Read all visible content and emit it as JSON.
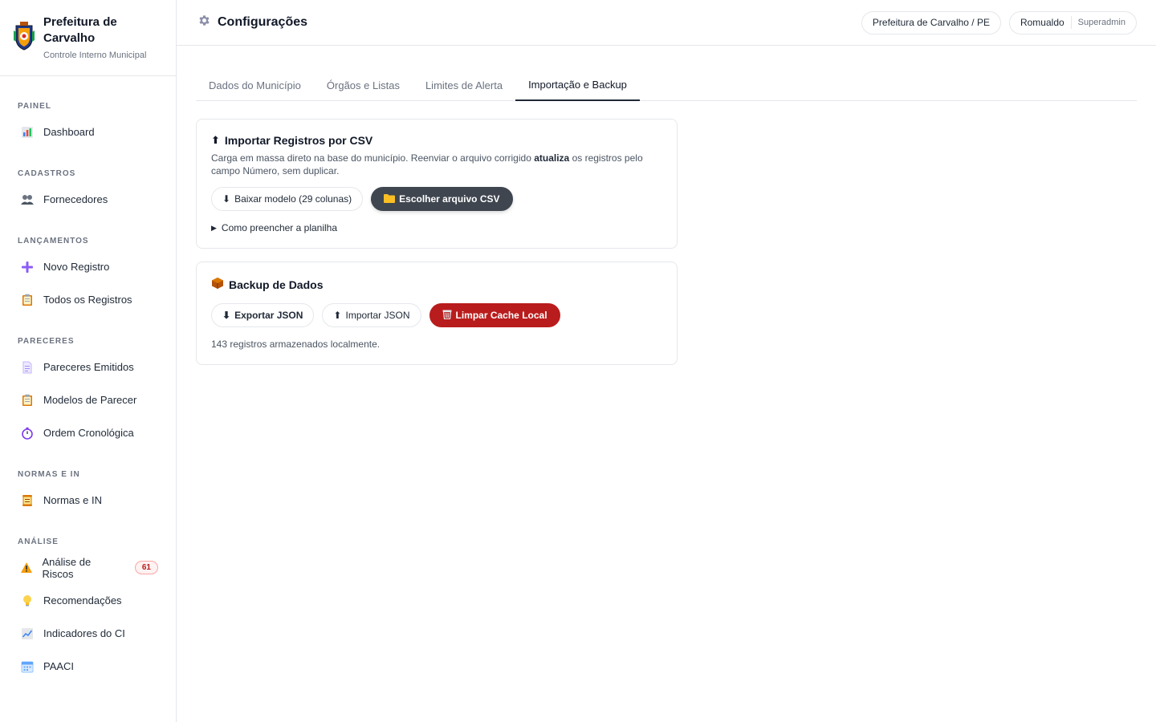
{
  "brand": {
    "title": "Prefeitura de Carvalho",
    "subtitle": "Controle Interno Municipal"
  },
  "sidebar": {
    "sections": [
      {
        "label": "PAINEL",
        "items": [
          {
            "label": "Dashboard",
            "icon": "chart-icon"
          }
        ]
      },
      {
        "label": "CADASTROS",
        "items": [
          {
            "label": "Fornecedores",
            "icon": "users-icon"
          }
        ]
      },
      {
        "label": "LANÇAMENTOS",
        "items": [
          {
            "label": "Novo Registro",
            "icon": "plus-icon"
          },
          {
            "label": "Todos os Registros",
            "icon": "clipboard-icon"
          }
        ]
      },
      {
        "label": "PARECERES",
        "items": [
          {
            "label": "Pareceres Emitidos",
            "icon": "document-icon"
          },
          {
            "label": "Modelos de Parecer",
            "icon": "clipboard-icon"
          },
          {
            "label": "Ordem Cronológica",
            "icon": "stopwatch-icon"
          }
        ]
      },
      {
        "label": "NORMAS E IN",
        "items": [
          {
            "label": "Normas e IN",
            "icon": "scroll-icon"
          }
        ]
      },
      {
        "label": "ANÁLISE",
        "items": [
          {
            "label": "Análise de Riscos",
            "icon": "warning-icon",
            "badge": "61"
          },
          {
            "label": "Recomendações",
            "icon": "lightbulb-icon"
          },
          {
            "label": "Indicadores do CI",
            "icon": "trend-icon"
          },
          {
            "label": "PAACI",
            "icon": "calendar-icon"
          }
        ]
      }
    ]
  },
  "header": {
    "title": "Configurações",
    "municipality": "Prefeitura de Carvalho / PE",
    "user": "Romualdo",
    "role": "Superadmin"
  },
  "tabs": [
    {
      "label": "Dados do Município",
      "active": false
    },
    {
      "label": "Órgãos e Listas",
      "active": false
    },
    {
      "label": "Limites de Alerta",
      "active": false
    },
    {
      "label": "Importação e Backup",
      "active": true
    }
  ],
  "import_card": {
    "title": "Importar Registros por CSV",
    "desc_before": "Carga em massa direto na base do município. Reenviar o arquivo corrigido ",
    "desc_bold": "atualiza",
    "desc_after": " os registros pelo campo Número, sem duplicar.",
    "download_label": "Baixar modelo (29 colunas)",
    "choose_label": "Escolher arquivo CSV",
    "howto_label": "Como preencher a planilha"
  },
  "backup_card": {
    "title": "Backup de Dados",
    "export_label": "Exportar JSON",
    "import_label": "Importar JSON",
    "clear_label": "Limpar Cache Local",
    "status": "143 registros armazenados localmente."
  },
  "colors": {
    "accent_dark": "#3f4650",
    "danger": "#b91c1c",
    "badge_text": "#b91c1c"
  }
}
